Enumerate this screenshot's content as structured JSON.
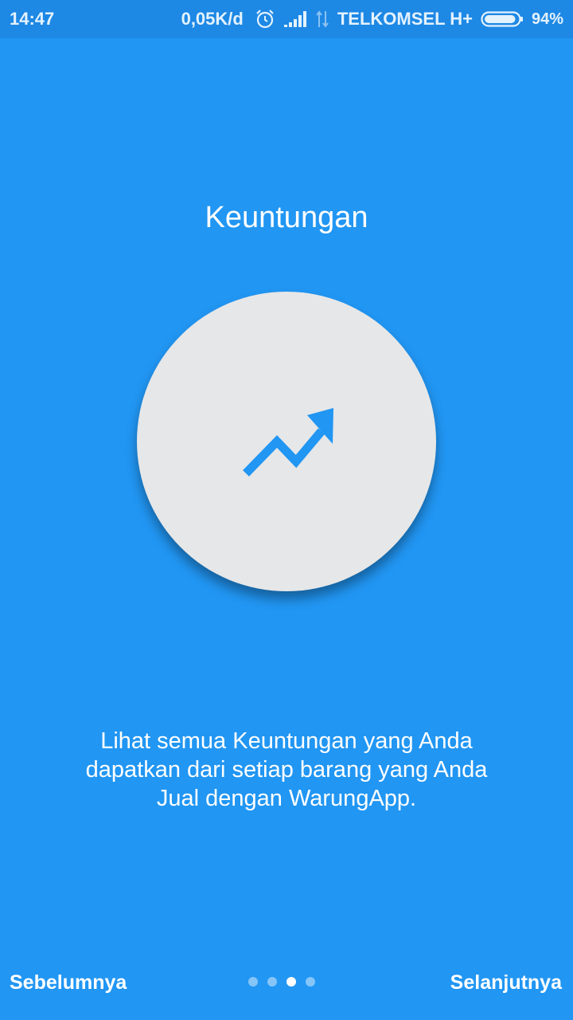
{
  "status_bar": {
    "time": "14:47",
    "net_speed": "0,05K/d",
    "carrier": "TELKOMSEL H+",
    "battery_percent": "94%",
    "battery_level": 0.94,
    "icons": [
      "alarm-clock-icon",
      "signal-bars-icon",
      "data-arrows-icon",
      "battery-icon"
    ]
  },
  "onboarding": {
    "title": "Keuntungan",
    "hero_icon": "trending-up-icon",
    "hero_icon_color": "#2196F3",
    "description": "Lihat semua Keuntungan yang Anda dapatkan dari setiap barang yang Anda Jual dengan WarungApp."
  },
  "navigation": {
    "prev_label": "Sebelumnya",
    "next_label": "Selanjutnya",
    "page_indicator": {
      "total": 4,
      "active_index": 2
    }
  },
  "colors": {
    "background": "#2196F3",
    "status_bar": "#1E88E5",
    "circle": "#E6E7E8",
    "text": "#FFFFFF"
  }
}
